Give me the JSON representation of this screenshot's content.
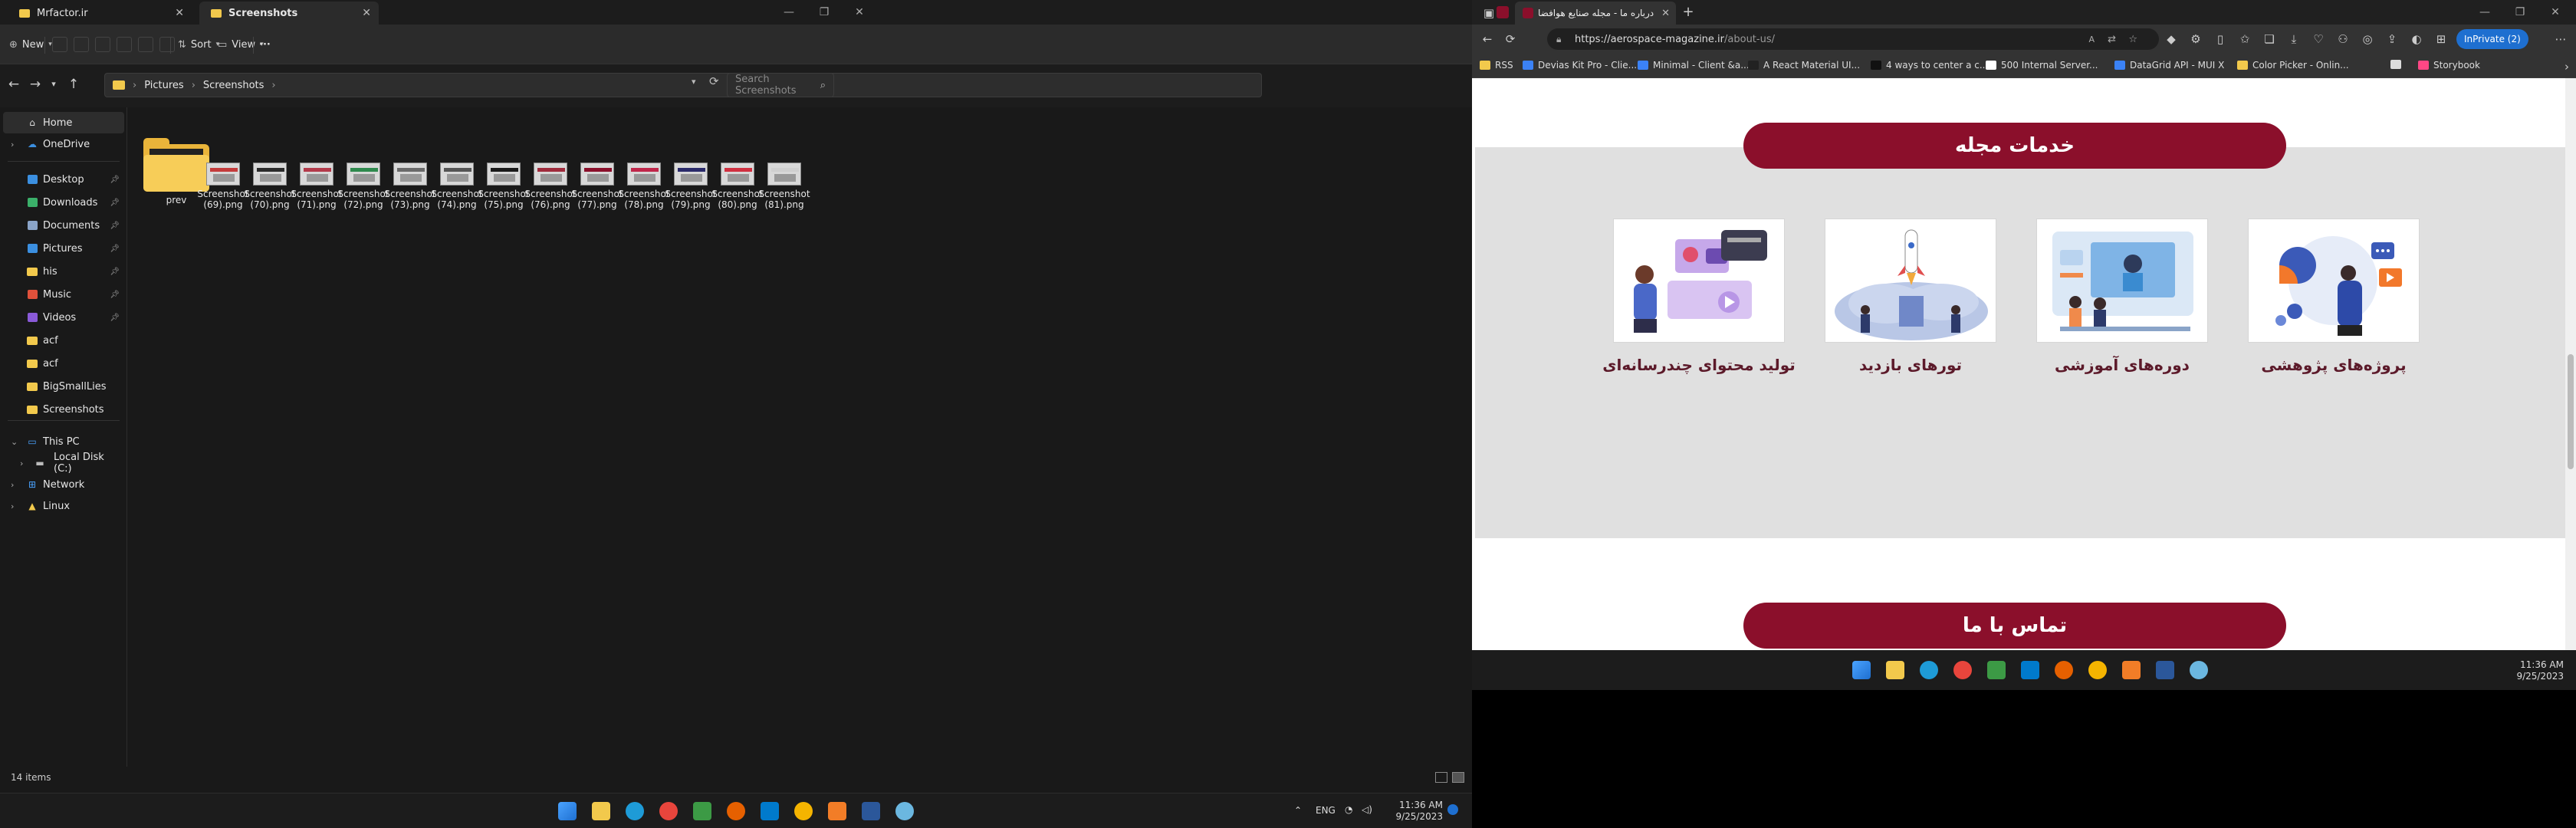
{
  "explorer": {
    "tabs": [
      {
        "label": "Mrfactor.ir",
        "active": false
      },
      {
        "label": "Screenshots",
        "active": true
      }
    ],
    "toolbar": {
      "new_label": "New",
      "sort_label": "Sort",
      "view_label": "View",
      "more_label": "···"
    },
    "breadcrumb": [
      "Pictures",
      "Screenshots"
    ],
    "search_placeholder": "Search Screenshots",
    "nav": {
      "home": "Home",
      "onedrive": "OneDrive",
      "quick": [
        {
          "label": "Desktop",
          "pinned": true
        },
        {
          "label": "Downloads",
          "pinned": true
        },
        {
          "label": "Documents",
          "pinned": true
        },
        {
          "label": "Pictures",
          "pinned": true
        },
        {
          "label": "his",
          "pinned": true
        },
        {
          "label": "Music",
          "pinned": true
        },
        {
          "label": "Videos",
          "pinned": true
        },
        {
          "label": "acf",
          "pinned": false
        },
        {
          "label": "acf",
          "pinned": false
        },
        {
          "label": "BigSmallLies",
          "pinned": false
        },
        {
          "label": "Screenshots",
          "pinned": false
        }
      ],
      "this_pc": "This PC",
      "local_disk": "Local Disk (C:)",
      "network": "Network",
      "linux": "Linux"
    },
    "files": [
      {
        "name": "prev",
        "type": "folder"
      },
      {
        "name": "Screenshot\n(69).png",
        "type": "image",
        "accent": "#c43b3b"
      },
      {
        "name": "Screenshot\n(70).png",
        "type": "image",
        "accent": "#2b2b2b"
      },
      {
        "name": "Screenshot\n(71).png",
        "type": "image",
        "accent": "#b33a4a"
      },
      {
        "name": "Screenshot\n(72).png",
        "type": "image",
        "accent": "#2f8a4e"
      },
      {
        "name": "Screenshot\n(73).png",
        "type": "image",
        "accent": "#6a6a6a"
      },
      {
        "name": "Screenshot\n(74).png",
        "type": "image",
        "accent": "#555555"
      },
      {
        "name": "Screenshot\n(75).png",
        "type": "image",
        "accent": "#1a1a1a"
      },
      {
        "name": "Screenshot\n(76).png",
        "type": "image",
        "accent": "#a02b3c"
      },
      {
        "name": "Screenshot\n(77).png",
        "type": "image",
        "accent": "#8b0f2b"
      },
      {
        "name": "Screenshot\n(78).png",
        "type": "image",
        "accent": "#c0264a"
      },
      {
        "name": "Screenshot\n(79).png",
        "type": "image",
        "accent": "#2a2a6a"
      },
      {
        "name": "Screenshot\n(80).png",
        "type": "image",
        "accent": "#d03040"
      },
      {
        "name": "Screenshot\n(81).png",
        "type": "image",
        "accent": "#cfcfcf"
      }
    ],
    "status": "14 items",
    "clock": {
      "time": "11:36 AM",
      "date": "9/25/2023"
    },
    "tray_lang": "ENG"
  },
  "browser": {
    "tab_title": "درباره ما - مجله صنایع هوافضا",
    "url_host": "https://aerospace-magazine.ir",
    "url_path": "/about-us/",
    "inprivate_label": "InPrivate (2)",
    "bookmarks": [
      {
        "label": "RSS",
        "color": "#f2c94c"
      },
      {
        "label": "Devias Kit Pro - Clie...",
        "color": "#3b82f6"
      },
      {
        "label": "Minimal - Client &a...",
        "color": "#3b82f6"
      },
      {
        "label": "A React Material UI...",
        "color": "#222222"
      },
      {
        "label": "4 ways to center a c...",
        "color": "#111111"
      },
      {
        "label": "500 Internal Server...",
        "color": "#ffffff"
      },
      {
        "label": "DataGrid API - MUI X",
        "color": "#3b82f6"
      },
      {
        "label": "Color Picker - Onlin...",
        "color": "#f2c94c"
      },
      {
        "label": "",
        "color": "#dddddd"
      },
      {
        "label": "Storybook",
        "color": "#ff4785"
      }
    ],
    "page": {
      "services_title": "خدمات مجله",
      "services": [
        {
          "label": "پروژه‌های پژوهشی"
        },
        {
          "label": "دوره‌های آموزشی"
        },
        {
          "label": "تورهای بازدید"
        },
        {
          "label": "تولید محتوای چندرسانه‌ای"
        }
      ],
      "contact_title": "تماس با ما"
    },
    "clock": {
      "time": "11:36 AM",
      "date": "9/25/2023"
    }
  }
}
